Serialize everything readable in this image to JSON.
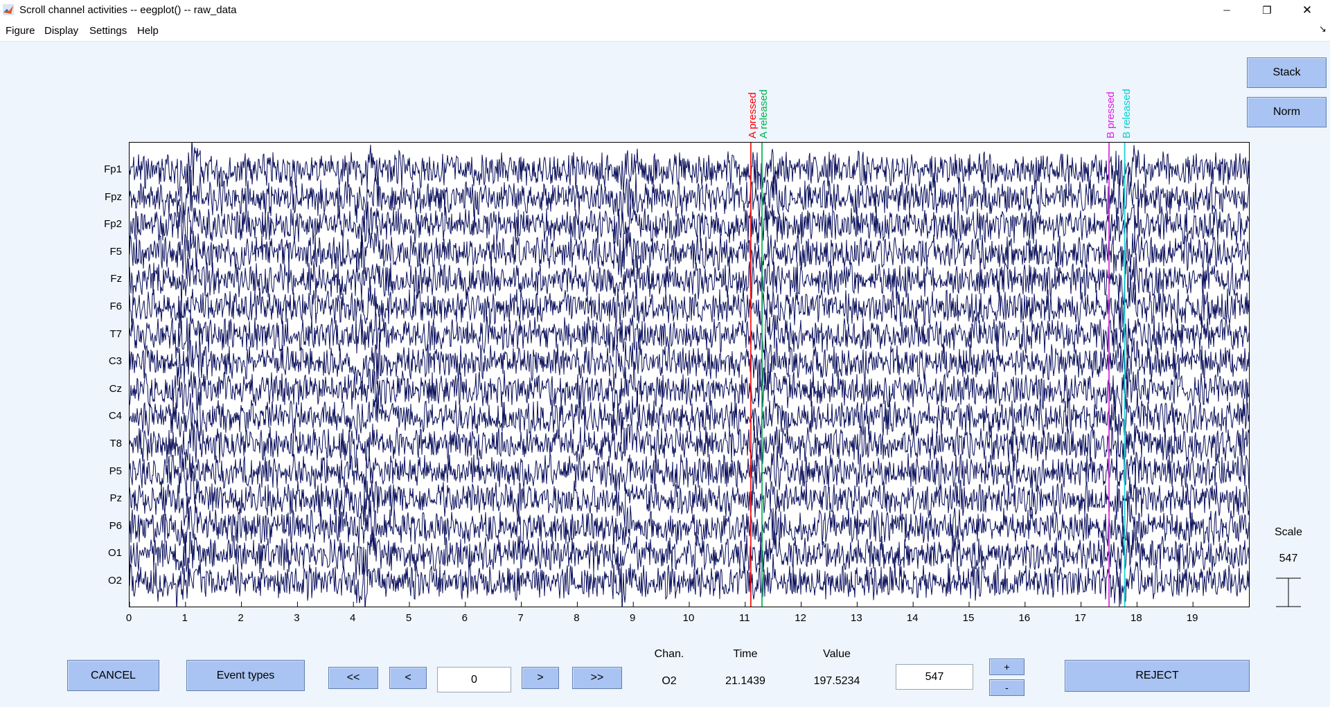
{
  "window": {
    "title": "Scroll channel activities -- eegplot() -- raw_data",
    "minimize_label": "─",
    "restore_label": "❐",
    "close_label": "✕"
  },
  "menu": {
    "items": [
      {
        "label": "Figure"
      },
      {
        "label": "Display"
      },
      {
        "label": "Settings"
      },
      {
        "label": "Help"
      }
    ],
    "dock_icon": "↘"
  },
  "channels": [
    "Fp1",
    "Fpz",
    "Fp2",
    "F5",
    "Fz",
    "F6",
    "T7",
    "C3",
    "Cz",
    "C4",
    "T8",
    "P5",
    "Pz",
    "P6",
    "O1",
    "O2"
  ],
  "x_ticks": [
    "0",
    "1",
    "2",
    "3",
    "4",
    "5",
    "6",
    "7",
    "8",
    "9",
    "10",
    "11",
    "12",
    "13",
    "14",
    "15",
    "16",
    "17",
    "18",
    "19"
  ],
  "events": [
    {
      "label": "A pressed",
      "time": 11.1,
      "color": "#ff0000"
    },
    {
      "label": "A released",
      "time": 11.3,
      "color": "#00b050"
    },
    {
      "label": "B pressed",
      "time": 17.5,
      "color": "#e020e0"
    },
    {
      "label": "B released",
      "time": 17.78,
      "color": "#00d0d0"
    }
  ],
  "plot": {
    "time_window": [
      0,
      20
    ],
    "trace_color": "#0a0f5a",
    "artifacts": [
      1.05,
      4.25,
      8.85,
      11.35,
      17.8
    ]
  },
  "side_buttons": {
    "stack": "Stack",
    "norm": "Norm"
  },
  "scale": {
    "title": "Scale",
    "value": "547"
  },
  "bottom": {
    "cancel": "CANCEL",
    "event_types": "Event types",
    "fast_back": "<<",
    "back": "<",
    "position_value": "0",
    "forward": ">",
    "fast_forward": ">>",
    "chan_header": "Chan.",
    "time_header": "Time",
    "value_header": "Value",
    "chan_value": "O2",
    "time_value": "21.1439",
    "value_value": "197.5234",
    "scale_input": "547",
    "plus": "+",
    "minus": "-",
    "reject": "REJECT"
  },
  "colors": {
    "background": "#eef5fc",
    "button": "#a9c3f2"
  }
}
